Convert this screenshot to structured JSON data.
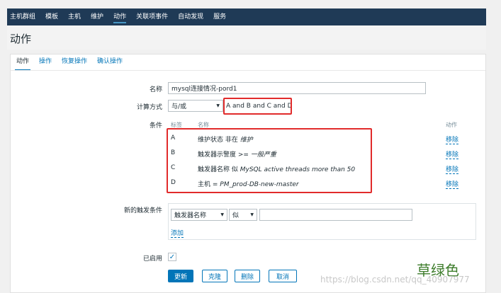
{
  "topnav": {
    "items": [
      "主机群组",
      "模板",
      "主机",
      "维护",
      "动作",
      "关联项事件",
      "自动发现",
      "服务"
    ],
    "active_index": 4
  },
  "page": {
    "title": "动作"
  },
  "tabs": [
    "动作",
    "操作",
    "恢复操作",
    "确认操作"
  ],
  "form": {
    "name_label": "名称",
    "name_value": "mysql连接情况-pord1",
    "calc_label": "计算方式",
    "calc_value": "与/或",
    "calc_expression": "A and B and C and D",
    "conditions_label": "条件",
    "conditions_header": {
      "label": "标签",
      "name": "名称",
      "action": "动作"
    },
    "conditions": [
      {
        "label": "A",
        "text_plain": "维护状态 非在 ",
        "text_italic": "维护",
        "remove": "移除"
      },
      {
        "label": "B",
        "text_plain": "触发器示警度 >= ",
        "text_italic": "一般严重",
        "remove": "移除"
      },
      {
        "label": "C",
        "text_plain": "触发器名称 似 ",
        "text_italic": "MySQL active threads more than 50",
        "remove": "移除"
      },
      {
        "label": "D",
        "text_plain": "主机 = ",
        "text_italic": "PM_prod-DB-new-master",
        "remove": "移除"
      }
    ],
    "new_condition_label": "新的触发条件",
    "new_condition_type": "触发器名称",
    "new_condition_operator": "似",
    "new_condition_value": "",
    "add_link": "添加",
    "enabled_label": "已启用",
    "enabled_checked": true
  },
  "buttons": {
    "update": "更新",
    "clone": "克隆",
    "delete": "删除",
    "cancel": "取消"
  },
  "annotation": {
    "grass_text": "草绿色"
  },
  "watermark": "https://blog.csdn.net/qq_40907977",
  "colors": {
    "accent": "#0275b8",
    "nav_bg": "#1f3a56",
    "highlight_red": "#e12b2b",
    "grass_green": "#3e7d2c"
  }
}
